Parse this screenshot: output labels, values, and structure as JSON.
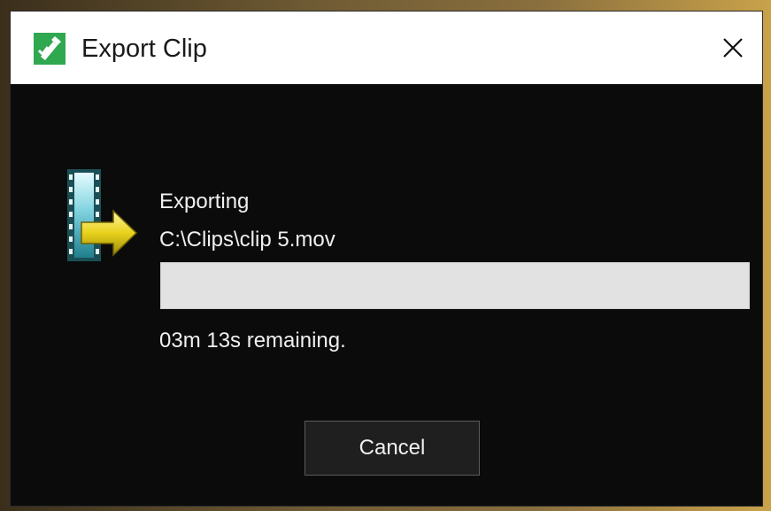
{
  "window": {
    "title": "Export Clip",
    "app_icon": "clapperboard-check-icon",
    "close_icon": "close-icon"
  },
  "export": {
    "icon": "film-export-arrow-icon",
    "status_label": "Exporting",
    "file_path": "C:\\Clips\\clip 5.mov",
    "progress_fraction": 0,
    "remaining_text": "03m 13s remaining."
  },
  "buttons": {
    "cancel_label": "Cancel"
  },
  "colors": {
    "title_bar": "#ffffff",
    "dialog_body": "#0b0b0b",
    "progress_track": "#e2e2e2",
    "progress_fill": "#06b025",
    "app_icon_green": "#2fa84f",
    "arrow_yellow": "#e8d21c"
  }
}
